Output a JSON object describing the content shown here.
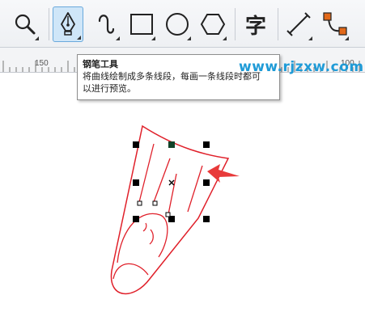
{
  "toolbar": {
    "tools": [
      {
        "name": "zoom-tool",
        "icon": "magnifier-icon"
      },
      {
        "name": "pen-tool",
        "icon": "pen-nib-icon",
        "active": true
      },
      {
        "name": "freehand-tool",
        "icon": "curve-icon"
      },
      {
        "name": "rectangle-tool",
        "icon": "rectangle-icon"
      },
      {
        "name": "ellipse-tool",
        "icon": "ellipse-icon"
      },
      {
        "name": "polygon-tool",
        "icon": "hexagon-icon"
      },
      {
        "name": "text-tool",
        "icon": "text-char-icon",
        "glyph": "字"
      },
      {
        "name": "dimension-tool",
        "icon": "diagonal-line-icon"
      },
      {
        "name": "connector-tool",
        "icon": "connector-icon"
      }
    ],
    "accent_color": "#6aa9dc",
    "connector_node_color": "#e2691a"
  },
  "ruler": {
    "labels": [
      "150",
      "100"
    ]
  },
  "tooltip": {
    "title": "钢笔工具",
    "line1": "将曲线绘制成多条线段，每画一条线段时都可",
    "line2": "以进行预览。"
  },
  "watermark": "www.rjzxw.com",
  "canvas": {
    "stroke_color": "#e0202a",
    "arrow_color": "#e83a3a",
    "handle_color": "#000000"
  }
}
